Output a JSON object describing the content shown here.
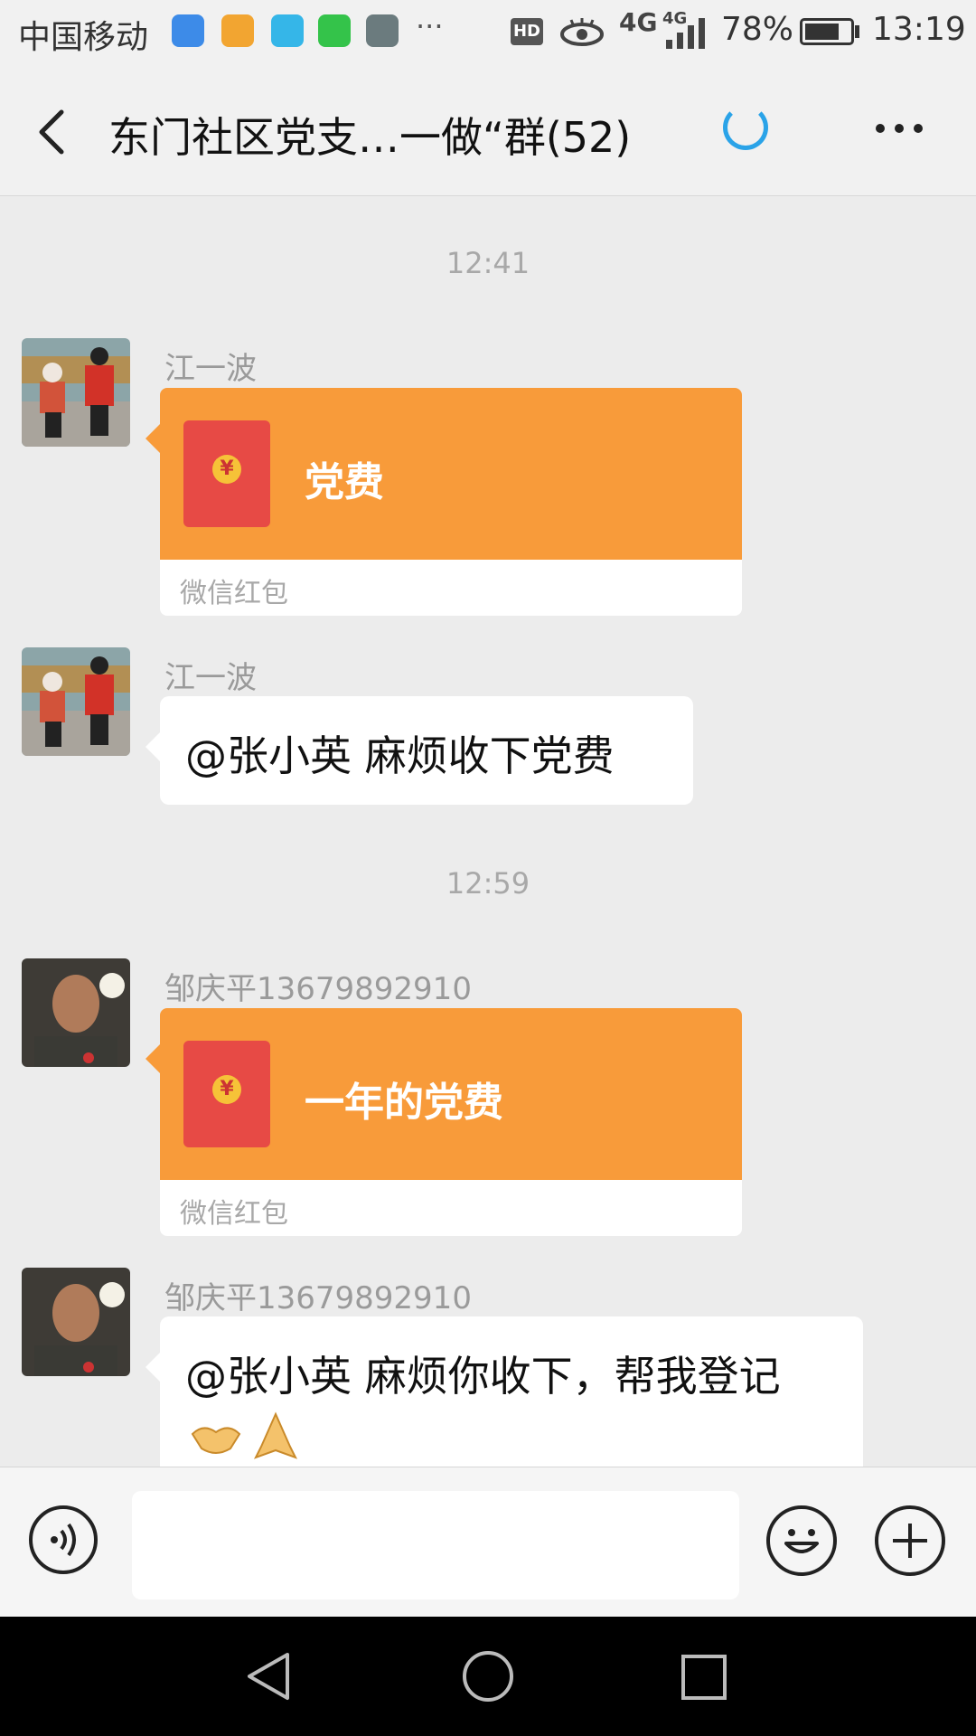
{
  "status_bar": {
    "carrier": "中国移动",
    "network_1": "4G",
    "network_2": "4G",
    "battery_percent": "78%",
    "battery_level": 0.78,
    "time": "13:19",
    "hd_label": "HD",
    "overflow": "···"
  },
  "header": {
    "title": "东门社区党支…一做“群(52)"
  },
  "messages": [
    {
      "type": "time",
      "text": "12:41"
    },
    {
      "type": "red_packet",
      "sender": "江一波",
      "title": "党费",
      "label": "微信红包"
    },
    {
      "type": "text",
      "sender": "江一波",
      "text": "@张小英  麻烦收下党费"
    },
    {
      "type": "time",
      "text": "12:59"
    },
    {
      "type": "red_packet",
      "sender": "邹庆平13679892910",
      "title": "一年的党费",
      "label": "微信红包"
    },
    {
      "type": "text",
      "sender": "邹庆平13679892910",
      "text": "@张小英  麻烦你收下，帮我登记",
      "emojis": [
        "handshake-emoji",
        "praying-hands-emoji"
      ]
    }
  ],
  "input_bar": {
    "placeholder": "",
    "icons": [
      "voice-icon",
      "emoji-icon",
      "plus-icon"
    ]
  },
  "system_nav": {
    "icons": [
      "back-triangle-icon",
      "home-circle-icon",
      "recents-square-icon"
    ]
  },
  "colors": {
    "red_packet_orange": "#f89b3a",
    "envelope_red": "#e74a45",
    "spinner_blue": "#2aa3e8",
    "chat_background": "#ececec"
  }
}
